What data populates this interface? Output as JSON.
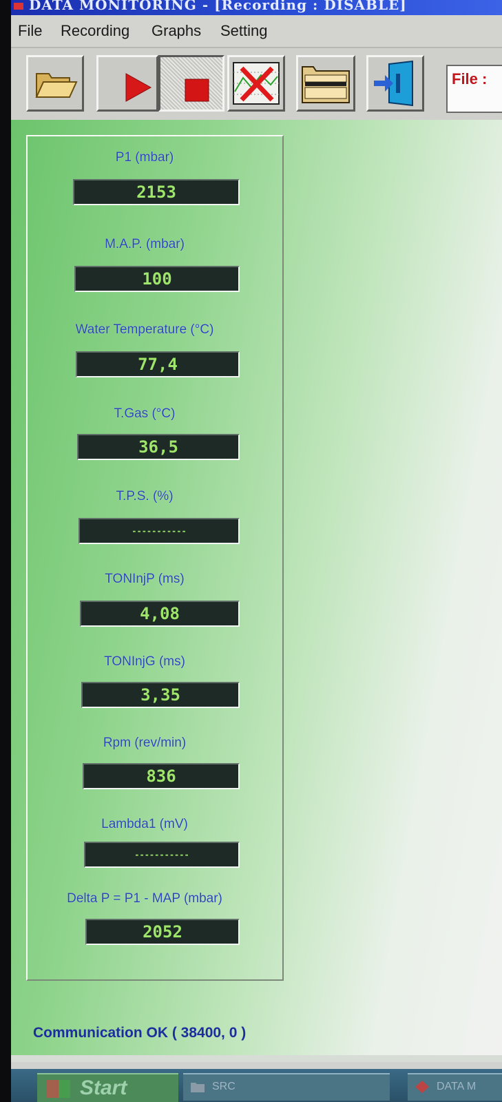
{
  "window": {
    "title": "DATA MONITORING - [Recording : DISABLE]"
  },
  "menu": {
    "items": [
      "File",
      "Recording",
      "Graphs",
      "Setting"
    ]
  },
  "toolbar": {
    "buttons": [
      {
        "name": "open-folder-button",
        "icon": "folder-icon"
      },
      {
        "name": "record-play-button",
        "icon": "play-icon"
      },
      {
        "name": "record-stop-button",
        "icon": "stop-icon"
      },
      {
        "name": "clear-graph-button",
        "icon": "clear-graph-icon"
      },
      {
        "name": "data-table-button",
        "icon": "table-icon"
      },
      {
        "name": "exit-button",
        "icon": "exit-door-icon"
      }
    ],
    "file_label": "File :"
  },
  "parameters": [
    {
      "label": "P1 (mbar)",
      "value": "2153"
    },
    {
      "label": "M.A.P. (mbar)",
      "value": "100"
    },
    {
      "label": "Water Temperature (°C)",
      "value": "77,4"
    },
    {
      "label": "T.Gas (°C)",
      "value": "36,5"
    },
    {
      "label": "T.P.S. (%)",
      "value": "-----------"
    },
    {
      "label": "TONInjP (ms)",
      "value": "4,08"
    },
    {
      "label": "TONInjG (ms)",
      "value": "3,35"
    },
    {
      "label": "Rpm (rev/min)",
      "value": "836"
    },
    {
      "label": "Lambda1 (mV)",
      "value": "-----------"
    },
    {
      "label": "Delta P = P1 - MAP (mbar)",
      "value": "2052"
    }
  ],
  "status": {
    "text": "Communication OK ( 38400,  0 )"
  },
  "taskbar": {
    "start_label": "Start",
    "tasks": [
      "SRC",
      "DATA M"
    ]
  },
  "colors": {
    "display_text": "#9ee56a",
    "label_text": "#2a47b6",
    "status_text": "#1c2e9c"
  }
}
